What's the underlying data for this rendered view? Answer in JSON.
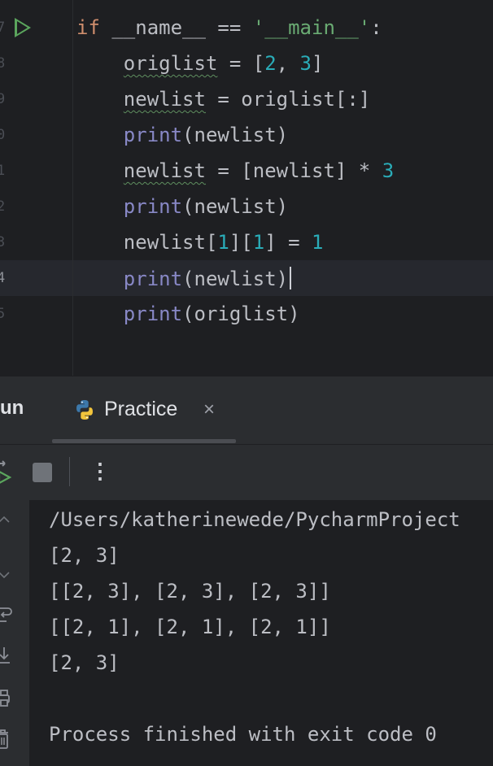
{
  "editor": {
    "gutter_numbers": [
      "7",
      "8",
      "9",
      "0",
      "1",
      "2",
      "3",
      "4",
      "5"
    ],
    "lines": [
      [
        {
          "t": "if",
          "c": "kw"
        },
        {
          "t": " __name__ == ",
          "c": ""
        },
        {
          "t": "'__main__'",
          "c": "str"
        },
        {
          "t": ":",
          "c": ""
        }
      ],
      [
        {
          "t": "    ",
          "c": ""
        },
        {
          "t": "origlist",
          "c": "squig"
        },
        {
          "t": " = [",
          "c": ""
        },
        {
          "t": "2",
          "c": "num"
        },
        {
          "t": ", ",
          "c": ""
        },
        {
          "t": "3",
          "c": "num"
        },
        {
          "t": "]",
          "c": ""
        }
      ],
      [
        {
          "t": "    ",
          "c": ""
        },
        {
          "t": "newlist",
          "c": "squig"
        },
        {
          "t": " = origlist[:]",
          "c": ""
        }
      ],
      [
        {
          "t": "    ",
          "c": ""
        },
        {
          "t": "print",
          "c": "fn"
        },
        {
          "t": "(newlist)",
          "c": ""
        }
      ],
      [
        {
          "t": "    ",
          "c": ""
        },
        {
          "t": "newlist",
          "c": "squig"
        },
        {
          "t": " = [newlist] * ",
          "c": ""
        },
        {
          "t": "3",
          "c": "num"
        }
      ],
      [
        {
          "t": "    ",
          "c": ""
        },
        {
          "t": "print",
          "c": "fn"
        },
        {
          "t": "(newlist)",
          "c": ""
        }
      ],
      [
        {
          "t": "    newlist[",
          "c": ""
        },
        {
          "t": "1",
          "c": "num"
        },
        {
          "t": "][",
          "c": ""
        },
        {
          "t": "1",
          "c": "num"
        },
        {
          "t": "] = ",
          "c": ""
        },
        {
          "t": "1",
          "c": "num"
        }
      ],
      [
        {
          "t": "    ",
          "c": ""
        },
        {
          "t": "print",
          "c": "fn"
        },
        {
          "t": "(newlist)",
          "c": ""
        }
      ],
      [
        {
          "t": "    ",
          "c": ""
        },
        {
          "t": "print",
          "c": "fn"
        },
        {
          "t": "(origlist)",
          "c": ""
        }
      ]
    ]
  },
  "run_panel": {
    "tab_run_label": "un",
    "tab_practice_label": "Practice",
    "tab_close_glyph": "×",
    "more_glyph": "⋮"
  },
  "console": {
    "lines": [
      "/Users/katherinewede/PycharmProject",
      "[2, 3]",
      "[[2, 3], [2, 3], [2, 3]]",
      "[[2, 1], [2, 1], [2, 1]]",
      "[2, 3]",
      "",
      "Process finished with exit code 0"
    ]
  },
  "icons": {
    "run_gutter": "run-arrow-icon",
    "python": "python-icon",
    "rerun": "rerun-icon",
    "stop": "stop-icon",
    "more": "more-vertical-icon",
    "soft_wrap": "soft-wrap-icon",
    "scroll_end": "scroll-to-end-icon",
    "print": "print-icon",
    "trash": "trash-icon"
  },
  "colors": {
    "keyword": "#cf8e6d",
    "string": "#6aab73",
    "number": "#2aacb8",
    "builtin": "#8888c6",
    "run_green": "#5ba55d"
  }
}
